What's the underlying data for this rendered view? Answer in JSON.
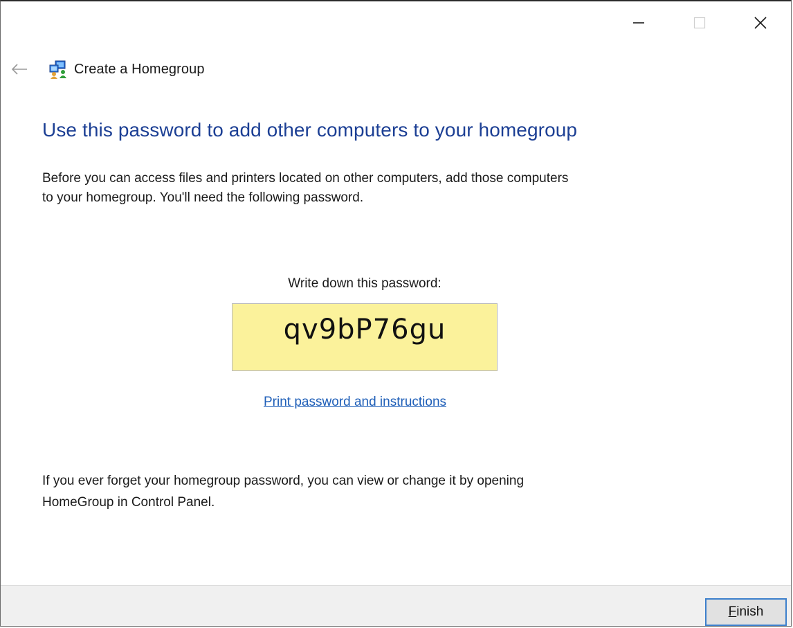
{
  "window": {
    "title": "Create a Homegroup",
    "caption_buttons": {
      "minimize_icon": "minimize-icon",
      "maximize_icon": "maximize-icon",
      "close_icon": "close-icon"
    }
  },
  "nav": {
    "back_icon": "back-arrow-icon",
    "app_icon": "homegroup-icon",
    "title": "Create a Homegroup"
  },
  "content": {
    "heading": "Use this password to add other computers to your homegroup",
    "description_line1": "Before you can access files and printers located on other computers, add those computers",
    "description_line2": "to your homegroup. You'll need the following password.",
    "password_label": "Write down this password:",
    "password": "qv9bP76gu",
    "print_link": "Print password and instructions",
    "footnote_line1": "If you ever forget your homegroup password, you can view or change it by opening",
    "footnote_line2": "HomeGroup in Control Panel."
  },
  "footer": {
    "finish_mnemonic": "F",
    "finish_rest": "inish"
  },
  "colors": {
    "heading": "#1c3f94",
    "link": "#1f5fb8",
    "password_box": "#fbf29b",
    "footer_bg": "#f0f0f0",
    "button_border": "#3c7fcb"
  }
}
